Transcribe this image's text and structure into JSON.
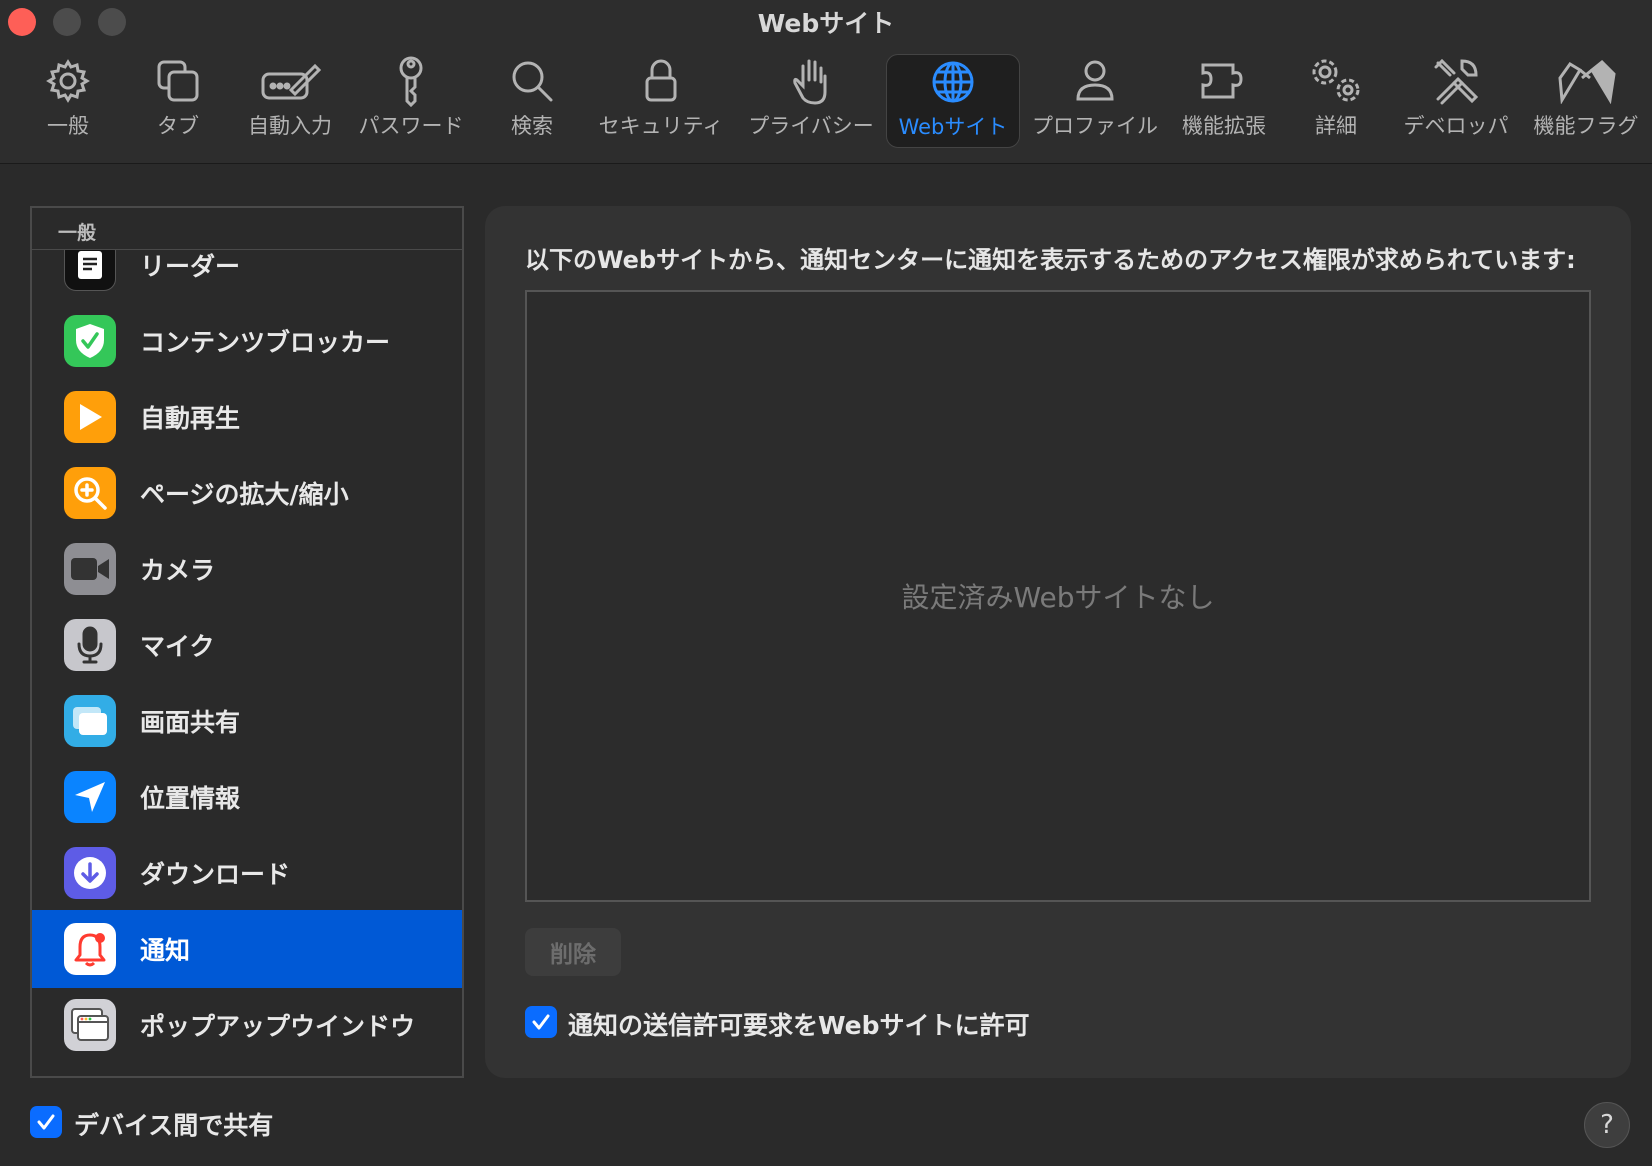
{
  "window": {
    "title": "Webサイト"
  },
  "toolbar": {
    "items": [
      {
        "label": "一般",
        "icon": "gear-icon"
      },
      {
        "label": "タブ",
        "icon": "tabs-icon"
      },
      {
        "label": "自動入力",
        "icon": "autofill-icon"
      },
      {
        "label": "パスワード",
        "icon": "key-icon"
      },
      {
        "label": "検索",
        "icon": "search-icon"
      },
      {
        "label": "セキュリティ",
        "icon": "lock-icon"
      },
      {
        "label": "プライバシー",
        "icon": "hand-icon"
      },
      {
        "label": "Webサイト",
        "icon": "globe-icon",
        "active": true
      },
      {
        "label": "プロファイル",
        "icon": "person-icon"
      },
      {
        "label": "機能拡張",
        "icon": "puzzle-icon"
      },
      {
        "label": "詳細",
        "icon": "gears-icon"
      },
      {
        "label": "デベロッパ",
        "icon": "tools-icon"
      },
      {
        "label": "機能フラグ",
        "icon": "flags-icon"
      }
    ],
    "accent_color": "#2a8cff"
  },
  "sidebar": {
    "header": "一般",
    "items": [
      {
        "label": "リーダー",
        "icon": "reader-icon"
      },
      {
        "label": "コンテンツブロッカー",
        "icon": "shield-check-icon"
      },
      {
        "label": "自動再生",
        "icon": "play-icon"
      },
      {
        "label": "ページの拡大/縮小",
        "icon": "zoom-icon"
      },
      {
        "label": "カメラ",
        "icon": "camera-icon"
      },
      {
        "label": "マイク",
        "icon": "microphone-icon"
      },
      {
        "label": "画面共有",
        "icon": "screen-share-icon"
      },
      {
        "label": "位置情報",
        "icon": "location-arrow-icon"
      },
      {
        "label": "ダウンロード",
        "icon": "download-icon"
      },
      {
        "label": "通知",
        "icon": "bell-icon",
        "selected": true
      },
      {
        "label": "ポップアップウインドウ",
        "icon": "popup-window-icon"
      }
    ],
    "selection_color": "#0059d6"
  },
  "main": {
    "description": "以下のWebサイトから、通知センターに通知を表示するためのアクセス権限が求められています:",
    "empty_text": "設定済みWebサイトなし",
    "delete_label": "削除",
    "allow_requests_label": "通知の送信許可要求をWebサイトに許可",
    "allow_requests_checked": true
  },
  "footer": {
    "share_label": "デバイス間で共有",
    "share_checked": true,
    "help_label": "?"
  }
}
